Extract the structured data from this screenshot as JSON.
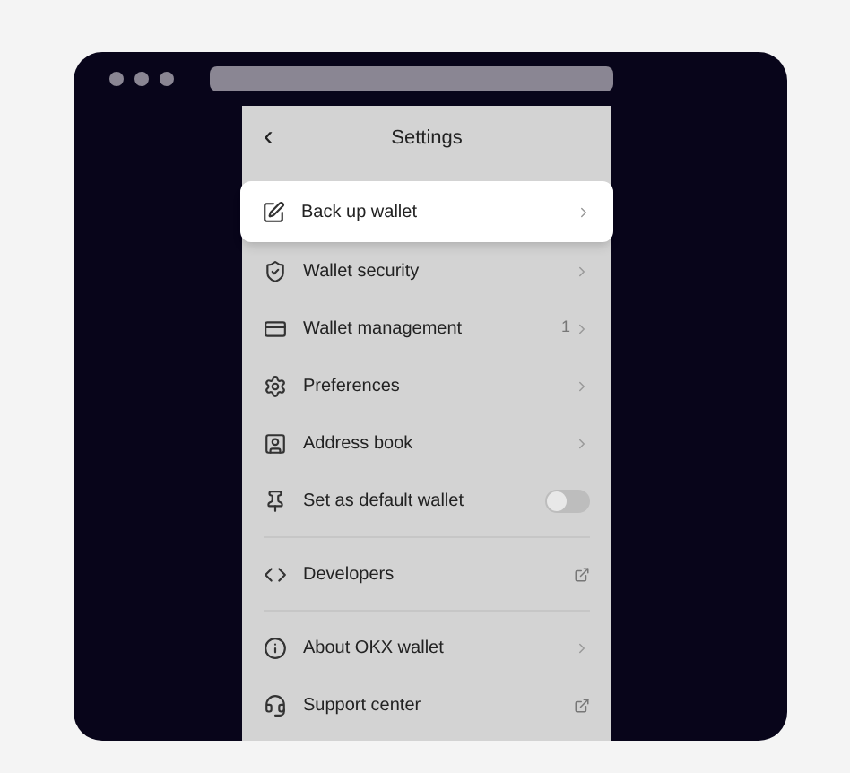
{
  "header": {
    "back": "‹",
    "title": "Settings"
  },
  "items": [
    {
      "kind": "chevron",
      "label": "Back up wallet",
      "selected": true
    },
    {
      "kind": "chevron",
      "label": "Wallet security",
      "selected": false
    },
    {
      "kind": "chevron",
      "label": "Wallet management",
      "badge": "1",
      "selected": false
    },
    {
      "kind": "chevron",
      "label": "Preferences",
      "selected": false
    },
    {
      "kind": "chevron",
      "label": "Address book",
      "selected": false
    },
    {
      "kind": "toggle",
      "label": "Set as default wallet",
      "on": false,
      "selected": false
    },
    {
      "kind": "divider"
    },
    {
      "kind": "external",
      "label": "Developers",
      "selected": false
    },
    {
      "kind": "divider"
    },
    {
      "kind": "chevron",
      "label": "About OKX wallet",
      "selected": false
    },
    {
      "kind": "external",
      "label": "Support center",
      "selected": false
    }
  ]
}
